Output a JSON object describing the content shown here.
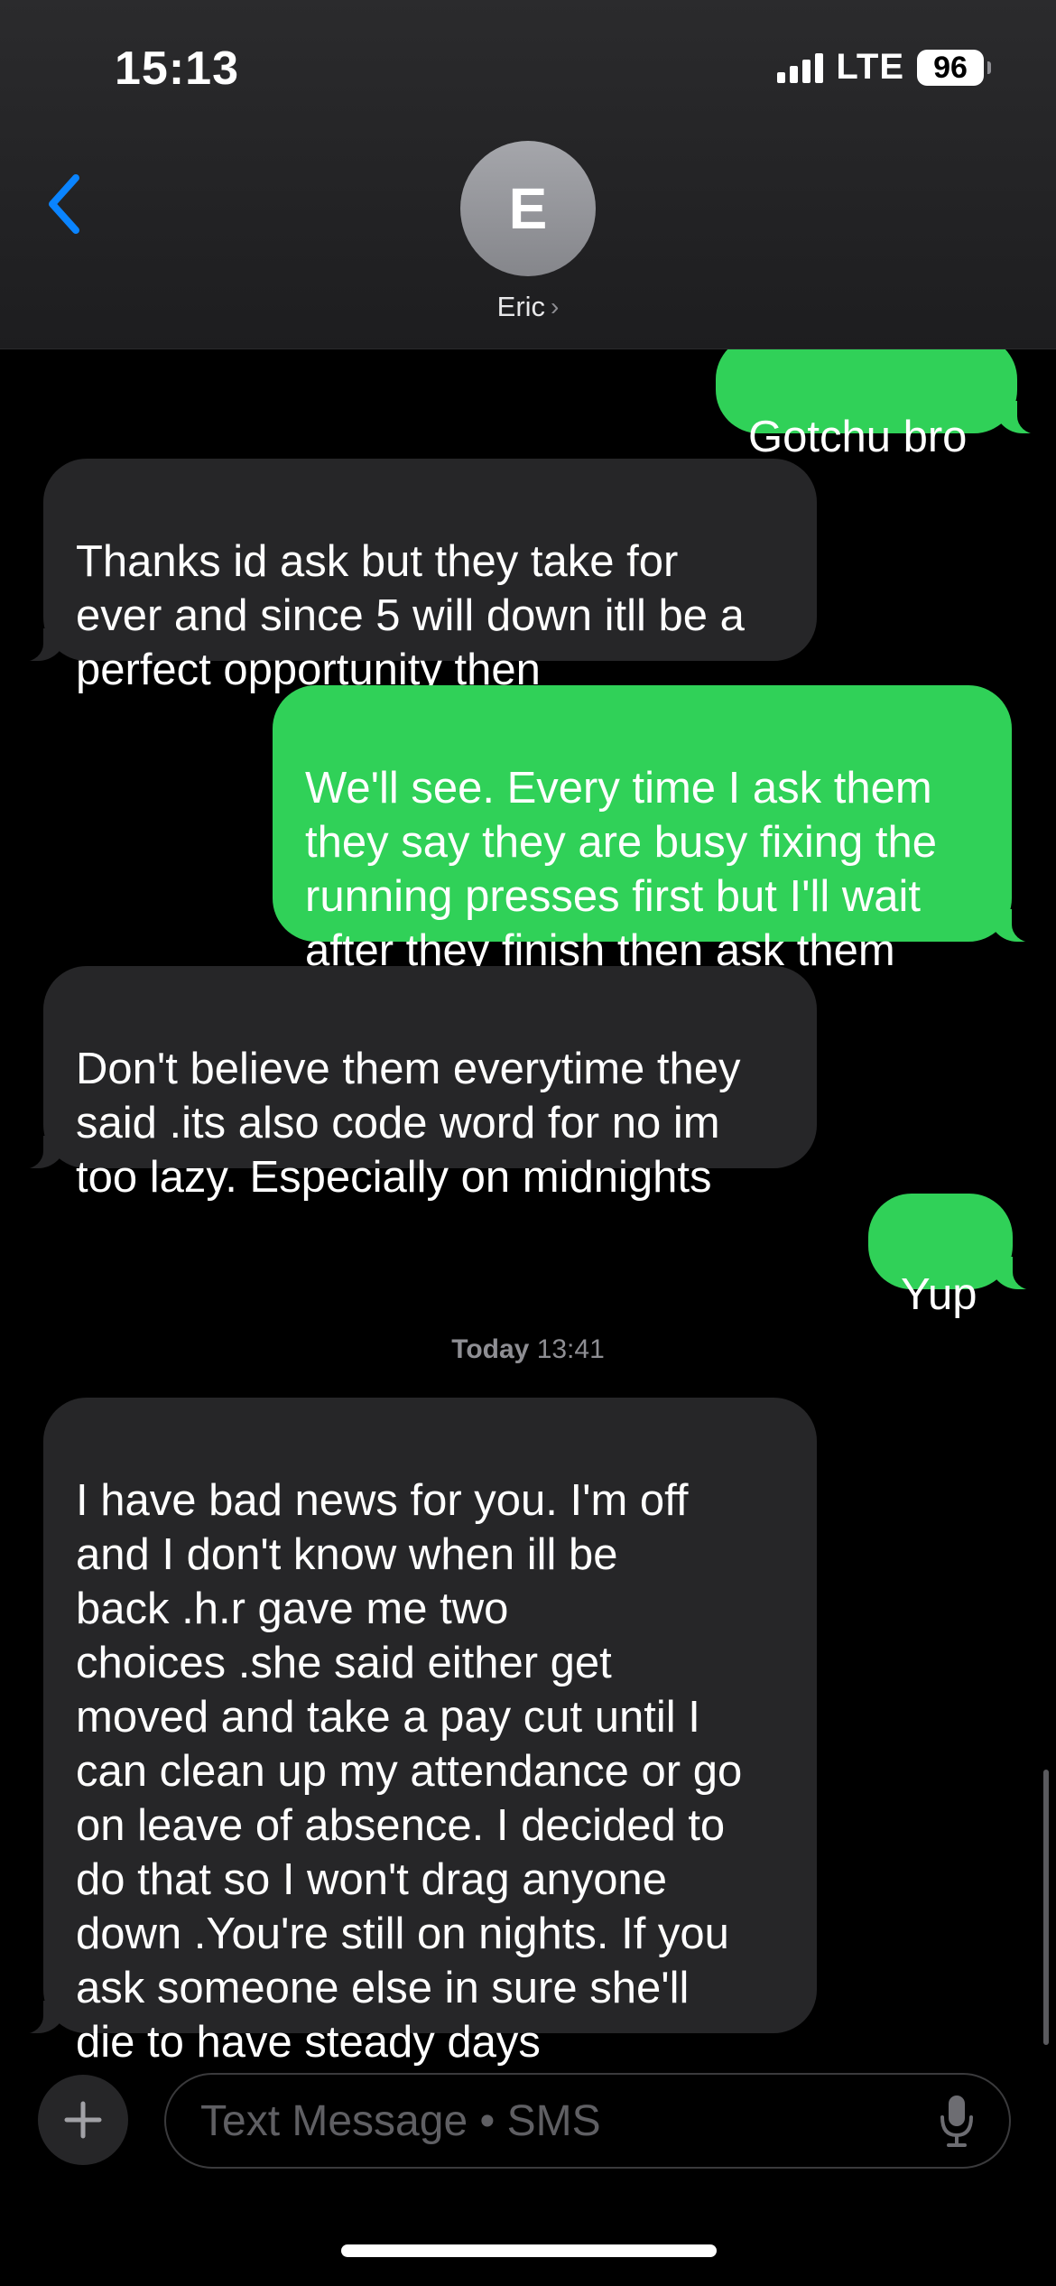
{
  "status_bar": {
    "time": "15:13",
    "network": "LTE",
    "battery": "96"
  },
  "contact": {
    "initial": "E",
    "name": "Eric",
    "name_chevron": "›"
  },
  "messages": [
    {
      "direction": "sent",
      "text": "Gotchu bro"
    },
    {
      "direction": "received",
      "text": "Thanks id ask but they take for\never and since 5 will down itll be a\nperfect opportunity then"
    },
    {
      "direction": "sent",
      "text": "We'll see. Every time I ask them\nthey say they are busy fixing the\nrunning presses first but I'll wait\nafter they finish then ask them"
    },
    {
      "direction": "received",
      "text": "Don't believe them everytime they\nsaid .its also code word for no im\ntoo lazy. Especially on midnights"
    },
    {
      "direction": "sent",
      "text": "Yup"
    },
    {
      "direction": "received",
      "text": "I have bad news for you. I'm off\nand I don't know when ill be\nback .h.r gave me two\nchoices .she said either get\nmoved and take a pay cut until I\ncan clean up my attendance or go\non leave of absence. I decided to\ndo that so I won't drag anyone\ndown .You're still on nights. If you\nask someone else in sure she'll\ndie to have steady days"
    }
  ],
  "timestamp": {
    "day": "Today",
    "time": "13:41"
  },
  "composer": {
    "placeholder": "Text Message • SMS"
  },
  "colors": {
    "sent_bubble": "#30d158",
    "received_bubble": "#262628",
    "back_arrow": "#0a84ff"
  },
  "icons": {
    "back": "chevron-left-icon",
    "add": "plus-icon",
    "mic": "microphone-icon"
  }
}
